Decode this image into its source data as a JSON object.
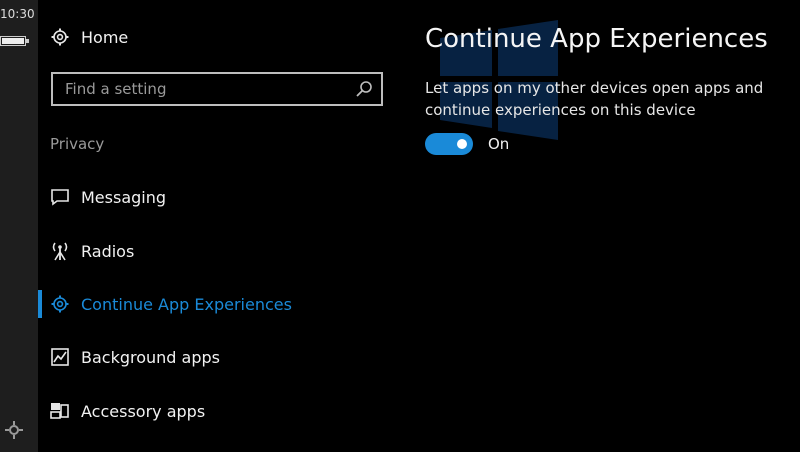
{
  "status_bar": {
    "time": "10:30"
  },
  "nav": {
    "home_label": "Home",
    "search": {
      "placeholder": "Find a setting"
    },
    "section_header": "Privacy",
    "items": [
      {
        "label": "Messaging",
        "icon": "chat-bubble-icon"
      },
      {
        "label": "Radios",
        "icon": "antenna-icon"
      },
      {
        "label": "Continue App Experiences",
        "icon": "gear-icon",
        "active": true
      },
      {
        "label": "Background apps",
        "icon": "chart-icon"
      },
      {
        "label": "Accessory apps",
        "icon": "devices-icon"
      }
    ]
  },
  "content": {
    "title": "Continue App Experiences",
    "description": "Let apps on my other devices open apps and continue experiences on this device",
    "toggle": {
      "state": "On",
      "on": true
    }
  },
  "colors": {
    "accent": "#1a8ad8",
    "background": "#000000",
    "text": "#ffffff",
    "muted": "#9a9a9a"
  }
}
